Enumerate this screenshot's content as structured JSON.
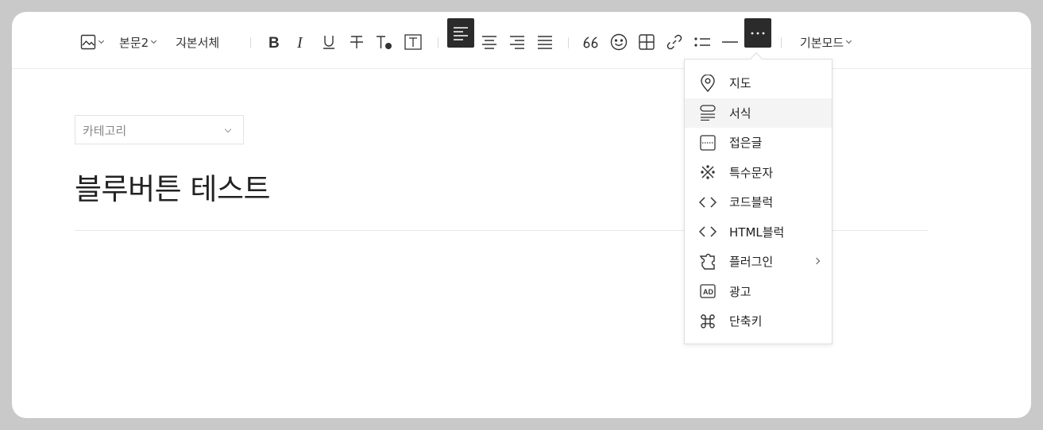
{
  "toolbar": {
    "paragraph_style": "본문2",
    "font_family": "기본서체",
    "mode": "기본모드"
  },
  "category": {
    "placeholder": "카테고리"
  },
  "post": {
    "title": "블루버튼 테스트"
  },
  "more_menu": {
    "items": [
      {
        "label": "지도",
        "icon": "map-pin-icon"
      },
      {
        "label": "서식",
        "icon": "template-icon"
      },
      {
        "label": "접은글",
        "icon": "fold-icon"
      },
      {
        "label": "특수문자",
        "icon": "special-char-icon"
      },
      {
        "label": "코드블럭",
        "icon": "code-icon"
      },
      {
        "label": "HTML블럭",
        "icon": "html-icon"
      },
      {
        "label": "플러그인",
        "icon": "plugin-icon"
      },
      {
        "label": "광고",
        "icon": "ad-icon"
      },
      {
        "label": "단축키",
        "icon": "command-icon"
      }
    ]
  },
  "colors": {
    "active_button": "#2b2b2b",
    "background": "#c9c9c9"
  }
}
